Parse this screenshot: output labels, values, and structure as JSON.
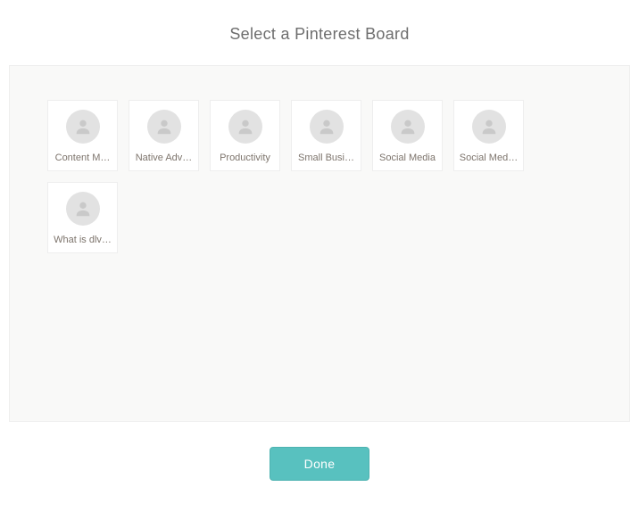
{
  "header": {
    "title": "Select a Pinterest Board"
  },
  "boards": [
    {
      "label": "Content M…"
    },
    {
      "label": "Native Adv…"
    },
    {
      "label": "Productivity"
    },
    {
      "label": "Small Busi…"
    },
    {
      "label": "Social Media"
    },
    {
      "label": "Social Med…"
    },
    {
      "label": "What is dlv…"
    }
  ],
  "footer": {
    "done_label": "Done"
  },
  "icons": {
    "avatar_placeholder": "person-icon"
  }
}
